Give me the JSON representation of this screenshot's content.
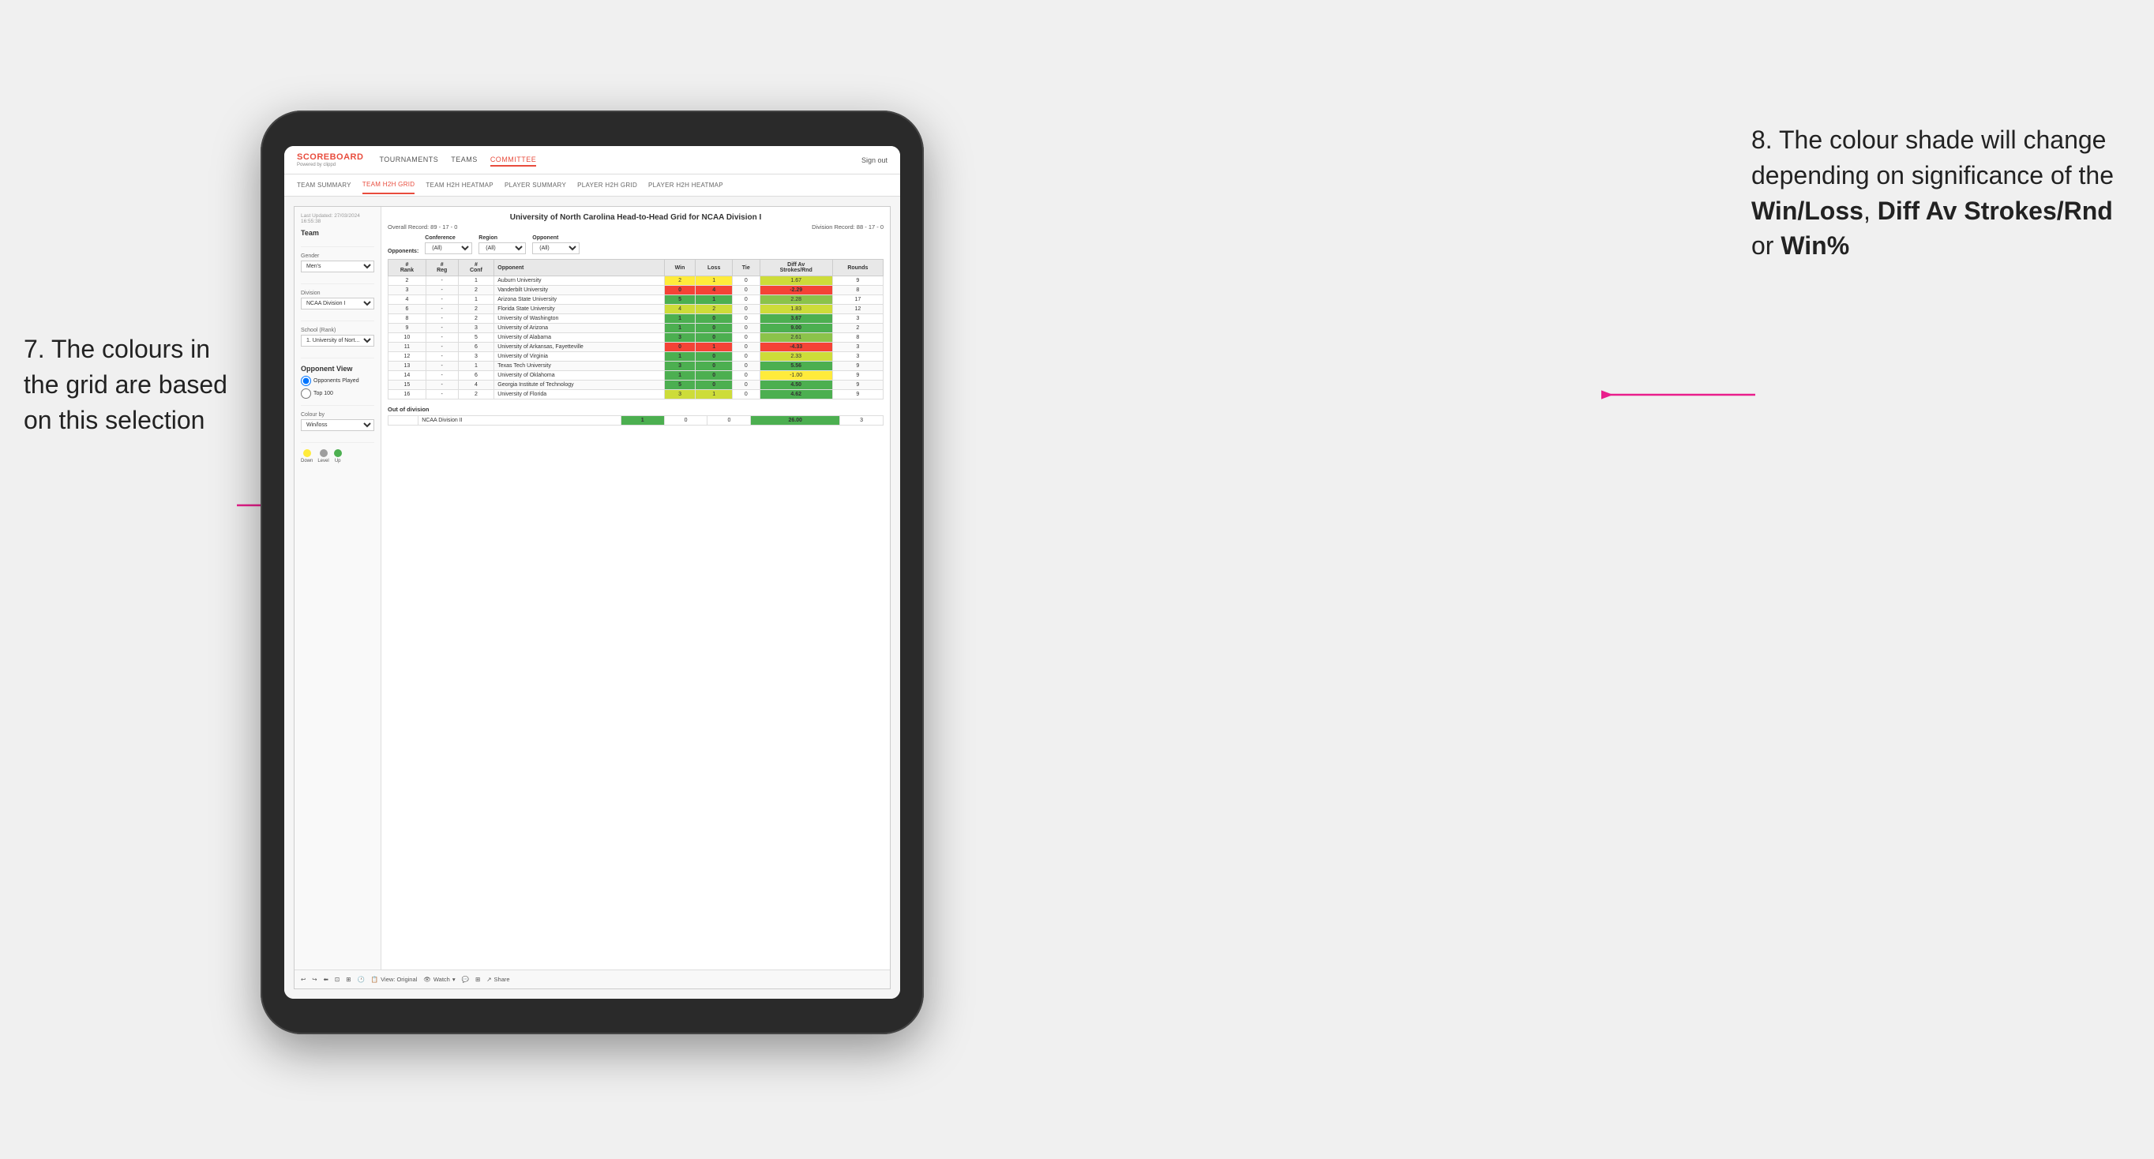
{
  "annotations": {
    "left": {
      "number": "7.",
      "text": "The colours in the grid are based on this selection"
    },
    "right": {
      "number": "8.",
      "text_before": " The colour shade will change depending on significance of the ",
      "bold1": "Win/Loss",
      "text_mid1": ", ",
      "bold2": "Diff Av Strokes/Rnd",
      "text_mid2": " or ",
      "bold3": "Win%"
    }
  },
  "app": {
    "logo": "SCOREBOARD",
    "logo_sub": "Powered by clippd",
    "nav": [
      "TOURNAMENTS",
      "TEAMS",
      "COMMITTEE"
    ],
    "nav_active": "COMMITTEE",
    "sign_out": "Sign out"
  },
  "sub_nav": [
    "TEAM SUMMARY",
    "TEAM H2H GRID",
    "TEAM H2H HEATMAP",
    "PLAYER SUMMARY",
    "PLAYER H2H GRID",
    "PLAYER H2H HEATMAP"
  ],
  "sub_nav_active": "TEAM H2H GRID",
  "sidebar": {
    "timestamp": "Last Updated: 27/03/2024\n16:55:38",
    "team_label": "Team",
    "gender_label": "Gender",
    "gender_value": "Men's",
    "division_label": "Division",
    "division_value": "NCAA Division I",
    "school_label": "School (Rank)",
    "school_value": "1. University of Nort...",
    "opponent_view_label": "Opponent View",
    "opponent_options": [
      "Opponents Played",
      "Top 100"
    ],
    "opponent_selected": "Opponents Played",
    "colour_by_label": "Colour by",
    "colour_by_value": "Win/loss",
    "legend": {
      "down": "Down",
      "level": "Level",
      "up": "Up"
    }
  },
  "grid": {
    "title": "University of North Carolina Head-to-Head Grid for NCAA Division I",
    "overall_record": "Overall Record: 89 - 17 - 0",
    "division_record": "Division Record: 88 - 17 - 0",
    "conference_filter": "Conference",
    "conference_value": "(All)",
    "region_filter": "Region",
    "region_value": "(All)",
    "opponent_filter": "Opponent",
    "opponent_value": "(All)",
    "opponents_label": "Opponents:",
    "columns": [
      "#\nRank",
      "#\nReg",
      "#\nConf",
      "Opponent",
      "Win",
      "Loss",
      "Tie",
      "Diff Av\nStrokes/Rnd",
      "Rounds"
    ],
    "rows": [
      {
        "rank": "2",
        "reg": "-",
        "conf": "1",
        "opponent": "Auburn University",
        "win": "2",
        "loss": "1",
        "tie": "0",
        "diff": "1.67",
        "rounds": "9",
        "win_color": "yellow",
        "diff_color": "green_light"
      },
      {
        "rank": "3",
        "reg": "-",
        "conf": "2",
        "opponent": "Vanderbilt University",
        "win": "0",
        "loss": "4",
        "tie": "0",
        "diff": "-2.29",
        "rounds": "8",
        "win_color": "red",
        "diff_color": "red"
      },
      {
        "rank": "4",
        "reg": "-",
        "conf": "1",
        "opponent": "Arizona State University",
        "win": "5",
        "loss": "1",
        "tie": "0",
        "diff": "2.28",
        "rounds": "",
        "win_color": "green_dark",
        "diff_color": "green_med",
        "extra": "17"
      },
      {
        "rank": "6",
        "reg": "-",
        "conf": "2",
        "opponent": "Florida State University",
        "win": "4",
        "loss": "2",
        "tie": "0",
        "diff": "1.83",
        "rounds": "12",
        "win_color": "green_light",
        "diff_color": "green_light"
      },
      {
        "rank": "8",
        "reg": "-",
        "conf": "2",
        "opponent": "University of Washington",
        "win": "1",
        "loss": "0",
        "tie": "0",
        "diff": "3.67",
        "rounds": "3",
        "win_color": "green_dark",
        "diff_color": "green_dark"
      },
      {
        "rank": "9",
        "reg": "-",
        "conf": "3",
        "opponent": "University of Arizona",
        "win": "1",
        "loss": "0",
        "tie": "0",
        "diff": "9.00",
        "rounds": "2",
        "win_color": "green_dark",
        "diff_color": "green_dark"
      },
      {
        "rank": "10",
        "reg": "-",
        "conf": "5",
        "opponent": "University of Alabama",
        "win": "3",
        "loss": "0",
        "tie": "0",
        "diff": "2.61",
        "rounds": "8",
        "win_color": "green_dark",
        "diff_color": "green_med"
      },
      {
        "rank": "11",
        "reg": "-",
        "conf": "6",
        "opponent": "University of Arkansas, Fayetteville",
        "win": "0",
        "loss": "1",
        "tie": "0",
        "diff": "-4.33",
        "rounds": "3",
        "win_color": "red",
        "diff_color": "red"
      },
      {
        "rank": "12",
        "reg": "-",
        "conf": "3",
        "opponent": "University of Virginia",
        "win": "1",
        "loss": "0",
        "tie": "0",
        "diff": "2.33",
        "rounds": "3",
        "win_color": "green_dark",
        "diff_color": "green_light"
      },
      {
        "rank": "13",
        "reg": "-",
        "conf": "1",
        "opponent": "Texas Tech University",
        "win": "3",
        "loss": "0",
        "tie": "0",
        "diff": "5.56",
        "rounds": "9",
        "win_color": "green_dark",
        "diff_color": "green_dark"
      },
      {
        "rank": "14",
        "reg": "-",
        "conf": "6",
        "opponent": "University of Oklahoma",
        "win": "1",
        "loss": "0",
        "tie": "0",
        "diff": "-1.00",
        "rounds": "9",
        "win_color": "green_dark",
        "diff_color": "yellow"
      },
      {
        "rank": "15",
        "reg": "-",
        "conf": "4",
        "opponent": "Georgia Institute of Technology",
        "win": "5",
        "loss": "0",
        "tie": "0",
        "diff": "4.50",
        "rounds": "9",
        "win_color": "green_dark",
        "diff_color": "green_dark"
      },
      {
        "rank": "16",
        "reg": "-",
        "conf": "2",
        "opponent": "University of Florida",
        "win": "3",
        "loss": "1",
        "tie": "0",
        "diff": "4.62",
        "rounds": "9",
        "win_color": "green_light",
        "diff_color": "green_dark"
      }
    ],
    "out_of_division_label": "Out of division",
    "out_of_division_row": {
      "division": "NCAA Division II",
      "win": "1",
      "loss": "0",
      "tie": "0",
      "diff": "26.00",
      "rounds": "3",
      "win_color": "green_dark",
      "diff_color": "green_dark"
    }
  },
  "tableau_bottom": {
    "view_label": "View: Original",
    "watch_label": "Watch",
    "share_label": "Share"
  }
}
